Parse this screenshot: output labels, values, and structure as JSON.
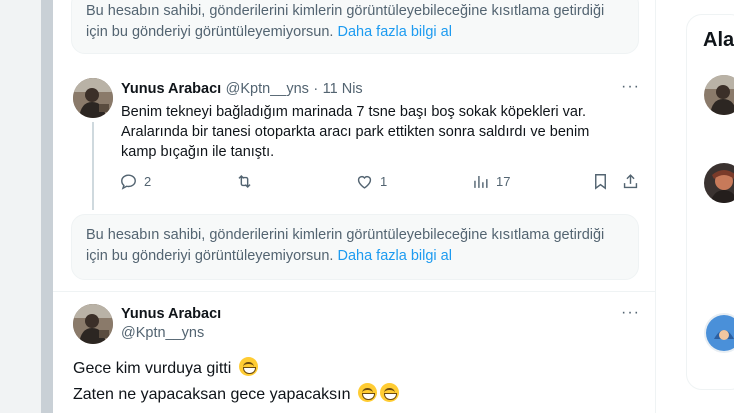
{
  "notices": [
    {
      "text": "Bu hesabın sahibi, gönderilerini kimlerin görüntüleyebileceğine kısıtlama getirdiği için bu gönderiyi görüntüleyemiyorsun.",
      "link": "Daha fazla bilgi al"
    },
    {
      "text": "Bu hesabın sahibi, gönderilerini kimlerin görüntüleyebileceğine kısıtlama getirdiği için bu gönderiyi görüntüleyemiyorsun.",
      "link": "Daha fazla bilgi al"
    }
  ],
  "reply_tweet": {
    "name": "Yunus Arabacı",
    "handle": "@Kptn__yns",
    "separator": "·",
    "date": "11 Nis",
    "more": "···",
    "lines": [
      "Benim tekneyi bağladığım marinada 7 tsne başı boş sokak köpekleri var.",
      "Aralarında bir tanesi otoparkta aracı park ettikten sonra saldırdı ve benim",
      "kamp bıçağın ile tanıştı."
    ],
    "stats": {
      "replies": "2",
      "retweets": "",
      "likes": "1",
      "views": "17"
    }
  },
  "main_tweet": {
    "name": "Yunus Arabacı",
    "handle": "@Kptn__yns",
    "more": "···",
    "line1": "Gece kim vurduya gitti",
    "line2": "Zaten ne yapacaksan gece yapacaksın"
  },
  "right_panel": {
    "title": "Ala"
  },
  "colors": {
    "link": "#1d9bf0",
    "muted": "#536471",
    "notice_bg": "#f7f9f9"
  },
  "icons": [
    "reply-icon",
    "retweet-icon",
    "like-icon",
    "views-icon",
    "bookmark-icon",
    "share-icon",
    "grinning-emoji"
  ]
}
